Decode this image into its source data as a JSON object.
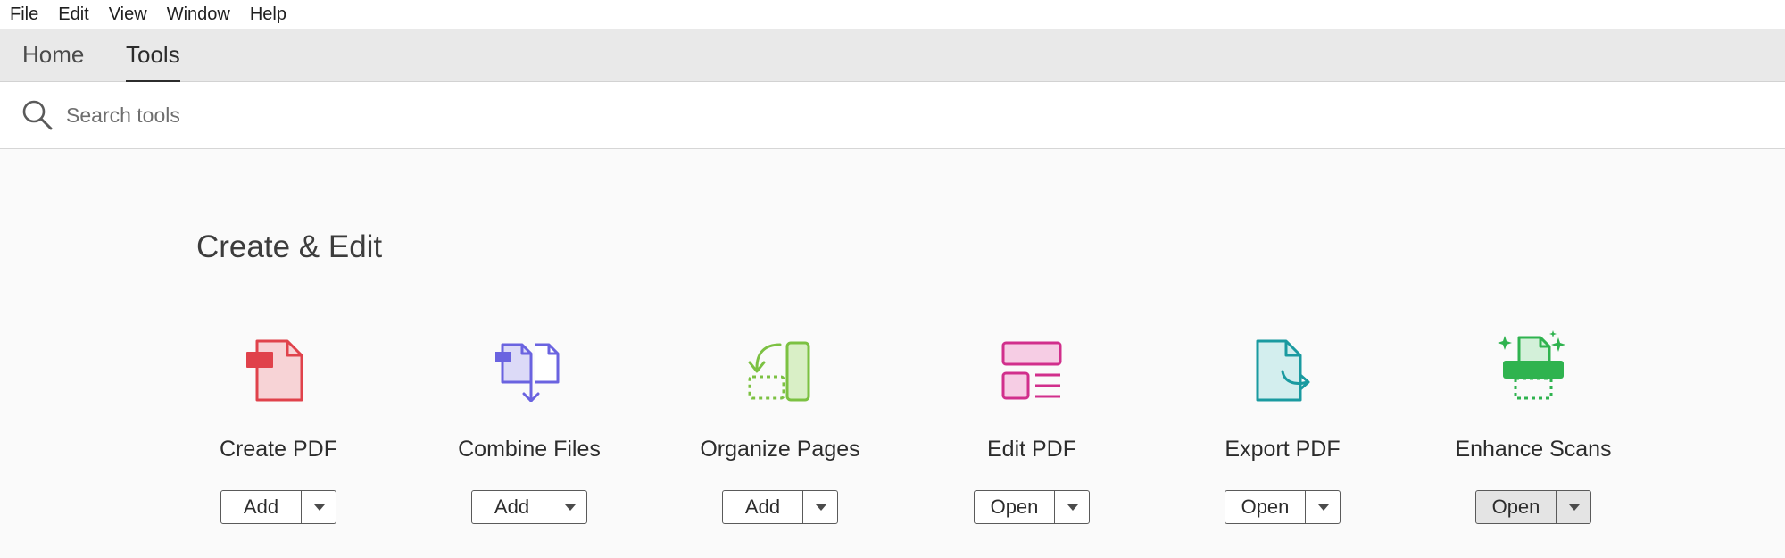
{
  "menubar": {
    "items": [
      "File",
      "Edit",
      "View",
      "Window",
      "Help"
    ]
  },
  "tabs": {
    "home": "Home",
    "tools": "Tools",
    "active": "Tools"
  },
  "search": {
    "placeholder": "Search tools",
    "value": ""
  },
  "section": {
    "title": "Create & Edit"
  },
  "tools": [
    {
      "name": "Create PDF",
      "button": "Add",
      "icon": "create-pdf-icon",
      "color": "#e0424b"
    },
    {
      "name": "Combine Files",
      "button": "Add",
      "icon": "combine-files-icon",
      "color": "#6a63e0"
    },
    {
      "name": "Organize Pages",
      "button": "Add",
      "icon": "organize-pages-icon",
      "color": "#7cc142"
    },
    {
      "name": "Edit PDF",
      "button": "Open",
      "icon": "edit-pdf-icon",
      "color": "#d12f8c"
    },
    {
      "name": "Export PDF",
      "button": "Open",
      "icon": "export-pdf-icon",
      "color": "#1a9aa0"
    },
    {
      "name": "Enhance Scans",
      "button": "Open",
      "icon": "enhance-scans-icon",
      "color": "#2fb34f"
    }
  ]
}
